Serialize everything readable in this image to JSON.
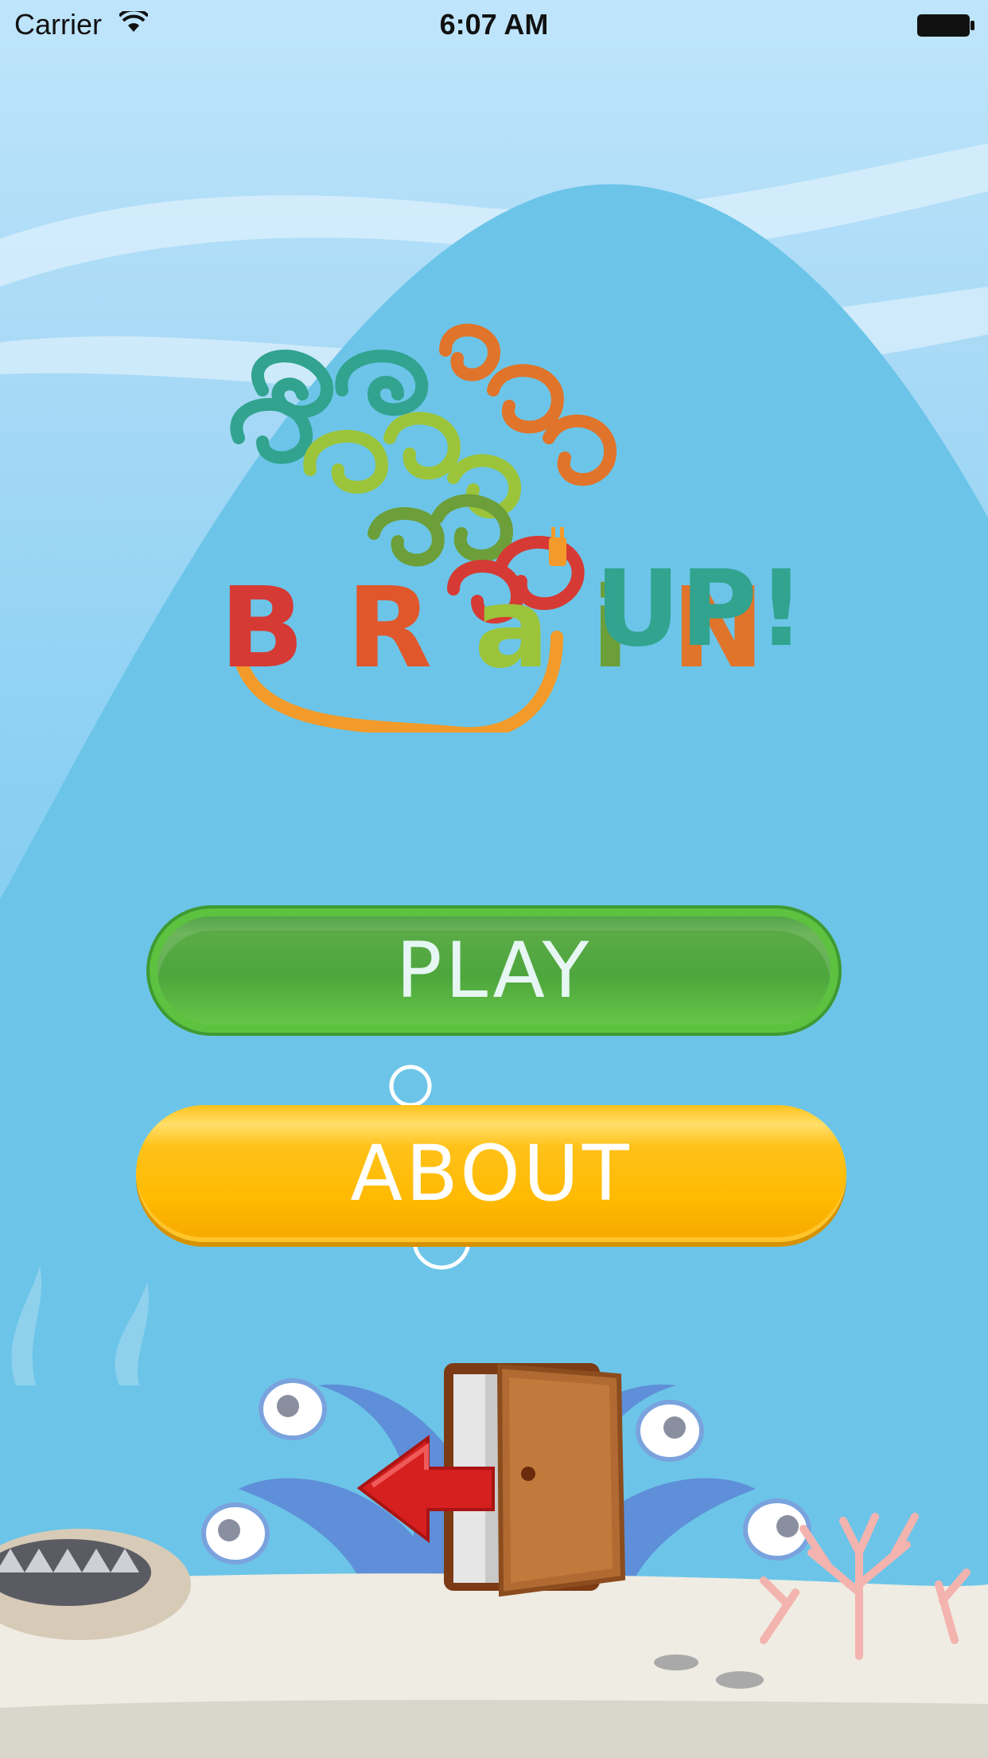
{
  "status_bar": {
    "carrier": "Carrier",
    "time": "6:07 AM"
  },
  "logo": {
    "letters": [
      "B",
      "R",
      "a",
      "i",
      "N"
    ],
    "letter_colors": [
      "#d63a34",
      "#e0572c",
      "#9bc43b",
      "#6c9f3a",
      "#e0742a"
    ],
    "suffix": "UP!",
    "suffix_colors": [
      "#31a38f",
      "#31a38f",
      "#d63a34"
    ],
    "icon": "brain-swirl-logo"
  },
  "menu": {
    "play_label": "PLAY",
    "about_label": "ABOUT",
    "exit_icon": "exit-door-icon"
  },
  "colors": {
    "play_button": "#4ea63d",
    "about_button": "#ffb900",
    "sky": "#8bd0f3"
  }
}
